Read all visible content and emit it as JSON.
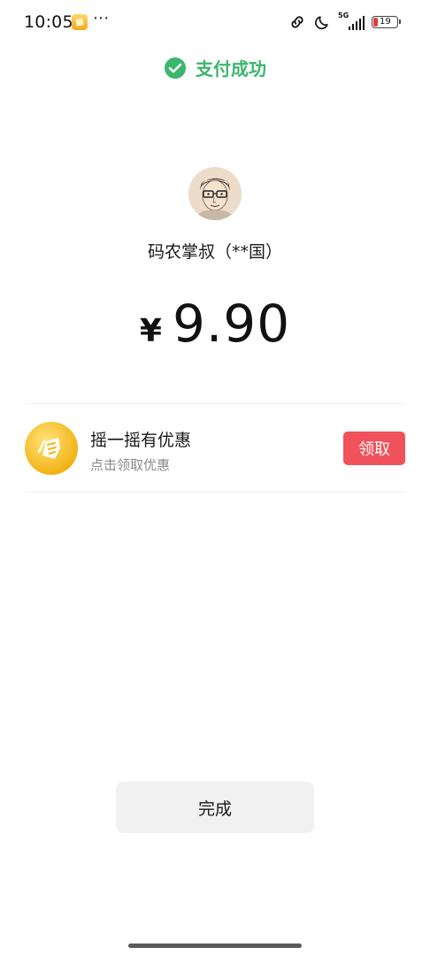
{
  "status_bar": {
    "time": "10:05",
    "more": "···",
    "network": "5G",
    "battery_level": "19",
    "battery_fraction": 0.19,
    "icons": [
      "app-notification-icon",
      "link-icon",
      "moon-icon",
      "signal-icon",
      "battery-icon"
    ]
  },
  "header": {
    "title": "支付成功",
    "icon": "wechat-pay-icon",
    "accent_color": "#3cb66d"
  },
  "payee": {
    "name": "码农掌叔（**国）",
    "avatar": "avatar-portrait"
  },
  "payment": {
    "currency": "¥",
    "amount": "9.90"
  },
  "promo": {
    "icon": "coupon-coin-icon",
    "title": "摇一摇有优惠",
    "subtitle": "点击领取优惠",
    "button_label": "领取",
    "button_color": "#f0515a"
  },
  "footer": {
    "done_label": "完成"
  }
}
